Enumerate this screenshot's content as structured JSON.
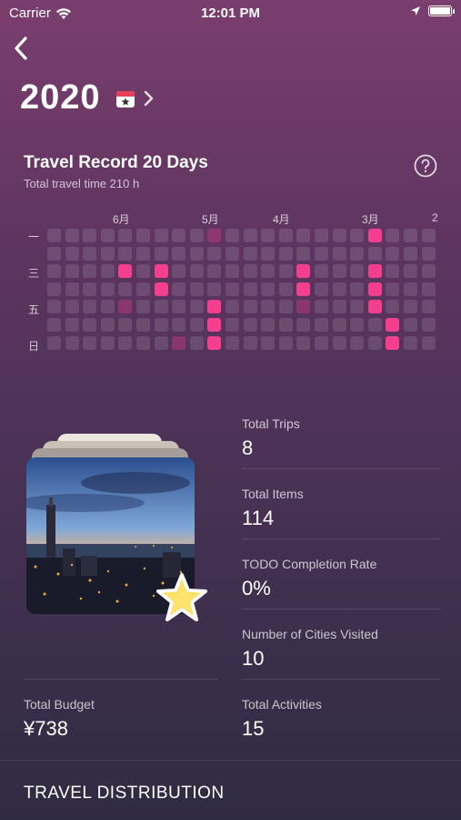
{
  "status_bar": {
    "carrier": "Carrier",
    "time": "12:01 PM"
  },
  "header": {
    "year": "2020"
  },
  "record": {
    "title": "Travel Record 20 Days",
    "subtitle": "Total travel time 210 h"
  },
  "heatmap": {
    "month_labels": [
      "6月",
      "5月",
      "4月",
      "3月",
      "2"
    ],
    "day_labels": [
      "一",
      "三",
      "五",
      "日"
    ],
    "columns": 22,
    "rows": 7,
    "active_cells": [
      [
        18,
        0
      ],
      [
        4,
        2
      ],
      [
        6,
        2
      ],
      [
        14,
        2
      ],
      [
        18,
        2
      ],
      [
        6,
        3
      ],
      [
        14,
        3
      ],
      [
        18,
        3
      ],
      [
        9,
        4
      ],
      [
        18,
        4
      ],
      [
        9,
        5
      ],
      [
        19,
        5
      ],
      [
        9,
        6
      ],
      [
        19,
        6
      ]
    ],
    "dim_cells": [
      [
        9,
        0
      ],
      [
        4,
        4
      ],
      [
        14,
        4
      ],
      [
        7,
        6
      ]
    ],
    "colors": {
      "active": "#f43f8e",
      "inactive": "rgba(255,255,255,0.12)"
    }
  },
  "stats": {
    "total_trips": {
      "label": "Total Trips",
      "value": "8"
    },
    "total_items": {
      "label": "Total Items",
      "value": "114"
    },
    "todo_rate": {
      "label": "TODO Completion Rate",
      "value": "0%"
    },
    "cities_visited": {
      "label": "Number of Cities Visited",
      "value": "10"
    },
    "total_budget": {
      "label": "Total Budget",
      "value": "¥738"
    },
    "total_activities": {
      "label": "Total Activities",
      "value": "15"
    }
  },
  "distribution": {
    "title": "TRAVEL DISTRIBUTION"
  },
  "icons": {
    "back": "chevron-left-icon",
    "calendar": "calendar-star-icon",
    "help": "question-circle-icon",
    "badge": "star-badge-icon"
  }
}
